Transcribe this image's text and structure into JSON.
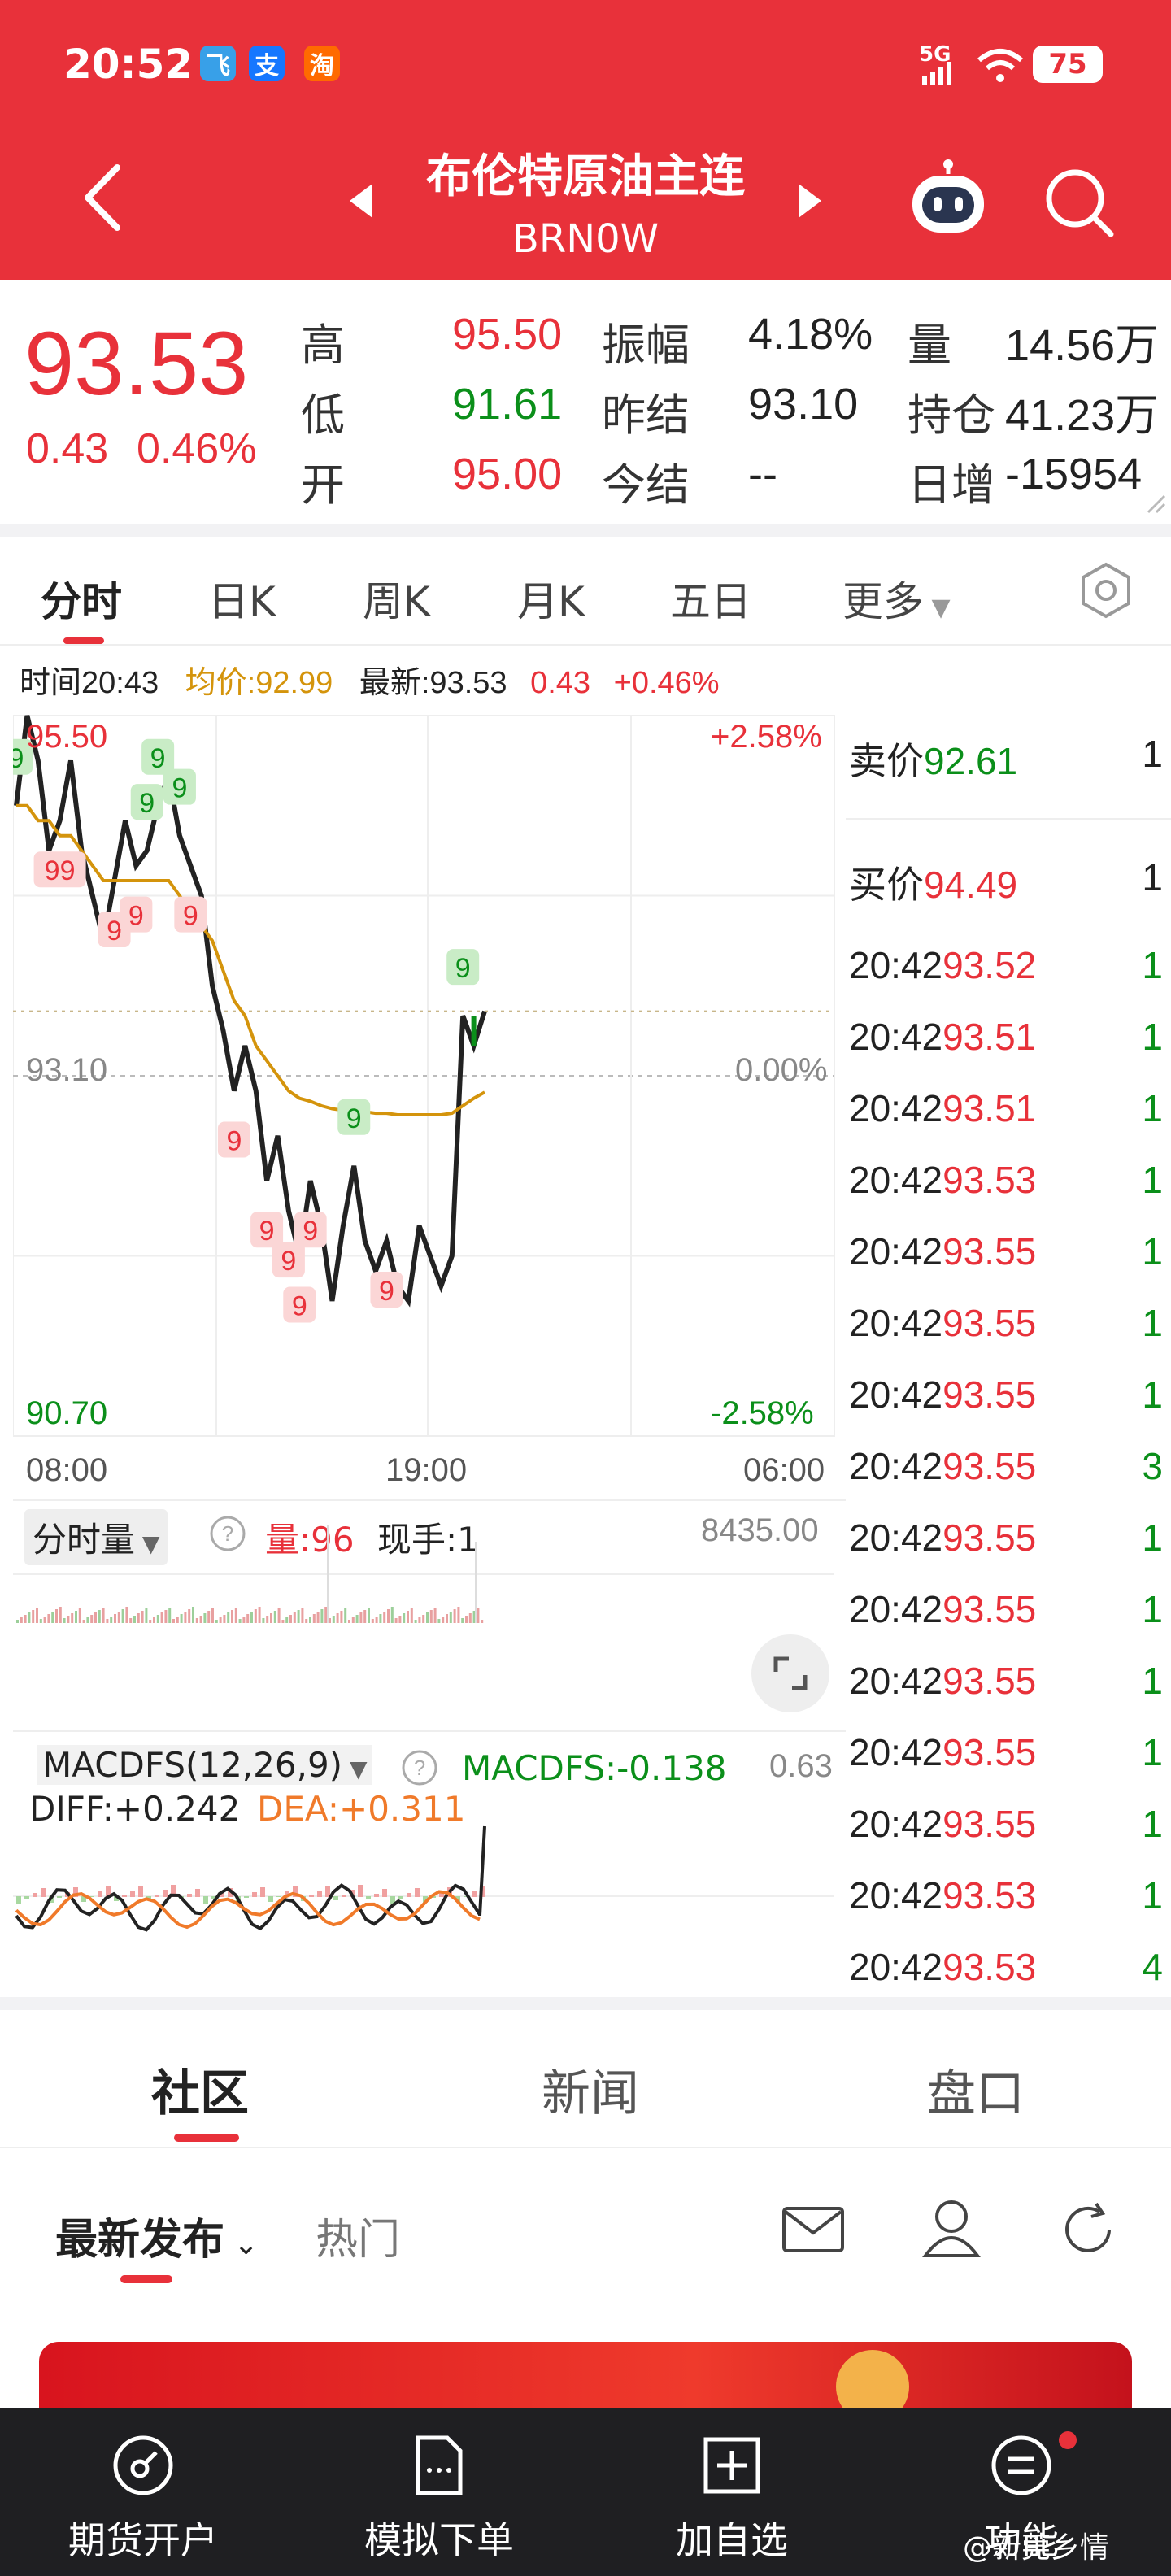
{
  "status_bar": {
    "time": "20:52",
    "apps": [
      "飞",
      "支",
      "淘"
    ],
    "network": "5G",
    "battery": "75"
  },
  "header": {
    "title": "布伦特原油主连",
    "subtitle": "BRN0W"
  },
  "quote": {
    "price": "93.53",
    "change": "0.43",
    "change_pct": "0.46%",
    "rows": [
      [
        {
          "l": "高",
          "v": "95.50",
          "c": "red"
        },
        {
          "l": "振幅",
          "v": "4.18%",
          "c": ""
        },
        {
          "l": "量",
          "v": "14.56万",
          "c": ""
        }
      ],
      [
        {
          "l": "低",
          "v": "91.61",
          "c": "green"
        },
        {
          "l": "昨结",
          "v": "93.10",
          "c": ""
        },
        {
          "l": "持仓",
          "v": "41.23万",
          "c": ""
        }
      ],
      [
        {
          "l": "开",
          "v": "95.00",
          "c": "red"
        },
        {
          "l": "今结",
          "v": "--",
          "c": ""
        },
        {
          "l": "日增",
          "v": "-15954",
          "c": ""
        }
      ]
    ]
  },
  "tabs": [
    "分时",
    "日K",
    "周K",
    "月K",
    "五日",
    "更多"
  ],
  "info_bar": {
    "time": "时间20:43",
    "avg": "均价:92.99",
    "latest": "最新:93.53",
    "chg": "0.43",
    "pct": "+0.46%"
  },
  "chart_data": {
    "type": "line",
    "series": [
      {
        "values": [
          94.9,
          95.5,
          95.2,
          94.6,
          94.8,
          95.2,
          94.6,
          94.3,
          94.0,
          94.4,
          94.8,
          94.5,
          94.6,
          94.9,
          95.1,
          94.7,
          94.5,
          94.3,
          93.7,
          93.4,
          93.0,
          93.3,
          93.0,
          92.4,
          92.7,
          92.2,
          91.9,
          92.4,
          92.1,
          91.6,
          92.1,
          92.5,
          92.0,
          91.8,
          92.0,
          91.7,
          91.6,
          92.1,
          91.9,
          91.7,
          91.9,
          93.5,
          93.3,
          93.53
        ]
      },
      {
        "values": [
          94.9,
          94.9,
          94.8,
          94.8,
          94.7,
          94.7,
          94.6,
          94.5,
          94.4,
          94.4,
          94.4,
          94.4,
          94.4,
          94.4,
          94.4,
          94.3,
          94.2,
          94.1,
          94.0,
          93.8,
          93.6,
          93.5,
          93.3,
          93.2,
          93.1,
          93.0,
          92.95,
          92.93,
          92.9,
          92.88,
          92.87,
          92.87,
          92.86,
          92.85,
          92.85,
          92.84,
          92.84,
          92.84,
          92.84,
          92.84,
          92.85,
          92.9,
          92.95,
          92.99
        ]
      }
    ],
    "ylim": [
      90.7,
      95.5
    ],
    "y_ticks": {
      "top": "95.50",
      "mid": "93.10",
      "bottom": "90.70"
    },
    "pct_ticks": {
      "top": "+2.58%",
      "mid": "0.00%",
      "bottom": "-2.58%"
    },
    "x_ticks": [
      "08:00",
      "19:00",
      "06:00"
    ],
    "signals": [
      {
        "i": 0,
        "t": "9",
        "k": "g"
      },
      {
        "i": 12,
        "t": "9",
        "k": "g"
      },
      {
        "i": 13,
        "t": "9",
        "k": "g"
      },
      {
        "i": 15,
        "t": "9",
        "k": "g"
      },
      {
        "i": 4,
        "t": "99",
        "k": "r"
      },
      {
        "i": 9,
        "t": "9",
        "k": "r"
      },
      {
        "i": 11,
        "t": "9",
        "k": "r"
      },
      {
        "i": 16,
        "t": "9",
        "k": "r"
      },
      {
        "i": 20,
        "t": "9",
        "k": "r"
      },
      {
        "i": 23,
        "t": "9",
        "k": "r"
      },
      {
        "i": 25,
        "t": "9",
        "k": "r"
      },
      {
        "i": 26,
        "t": "9",
        "k": "r"
      },
      {
        "i": 27,
        "t": "9",
        "k": "r"
      },
      {
        "i": 31,
        "t": "9",
        "k": "g"
      },
      {
        "i": 34,
        "t": "9",
        "k": "r"
      },
      {
        "i": 41,
        "t": "9",
        "k": "g"
      }
    ]
  },
  "volume": {
    "label": "分时量",
    "vol": "量:96",
    "now": "现手:1",
    "max": "8435.00"
  },
  "macd": {
    "label": "MACDFS(12,26,9)",
    "macdfs": "MACDFS:-0.138",
    "diff": "DIFF:+0.242",
    "dea": "DEA:+0.311",
    "max": "0.63"
  },
  "trades": {
    "sell": {
      "label": "卖价",
      "price": "92.61",
      "vol": "1"
    },
    "buy": {
      "label": "买价",
      "price": "94.49",
      "vol": "1"
    },
    "rows": [
      {
        "t": "20:42",
        "p": "93.52",
        "v": "1",
        "vc": "green"
      },
      {
        "t": "20:42",
        "p": "93.51",
        "v": "1",
        "vc": "green"
      },
      {
        "t": "20:42",
        "p": "93.51",
        "v": "1",
        "vc": "green"
      },
      {
        "t": "20:42",
        "p": "93.53",
        "v": "1",
        "vc": "green"
      },
      {
        "t": "20:42",
        "p": "93.55",
        "v": "1",
        "vc": "green"
      },
      {
        "t": "20:42",
        "p": "93.55",
        "v": "1",
        "vc": "green"
      },
      {
        "t": "20:42",
        "p": "93.55",
        "v": "1",
        "vc": "green"
      },
      {
        "t": "20:42",
        "p": "93.55",
        "v": "3",
        "vc": "green"
      },
      {
        "t": "20:42",
        "p": "93.55",
        "v": "1",
        "vc": "green"
      },
      {
        "t": "20:42",
        "p": "93.55",
        "v": "1",
        "vc": "green"
      },
      {
        "t": "20:42",
        "p": "93.55",
        "v": "1",
        "vc": "green"
      },
      {
        "t": "20:42",
        "p": "93.55",
        "v": "1",
        "vc": "green"
      },
      {
        "t": "20:42",
        "p": "93.55",
        "v": "1",
        "vc": "green"
      },
      {
        "t": "20:42",
        "p": "93.53",
        "v": "1",
        "vc": "green"
      },
      {
        "t": "20:42",
        "p": "93.53",
        "v": "4",
        "vc": "green"
      }
    ]
  },
  "community": {
    "tabs": [
      "社区",
      "新闻",
      "盘口"
    ],
    "sub_tabs": [
      "最新发布",
      "热门"
    ]
  },
  "bottom_bar": [
    "期货开户",
    "模拟下单",
    "加自选",
    "功能"
  ],
  "watermark": "@新莞乡情",
  "colors": {
    "accent": "#e8313a",
    "up": "#e8313a",
    "down": "#0b8f1a",
    "avg": "#d4940c"
  }
}
